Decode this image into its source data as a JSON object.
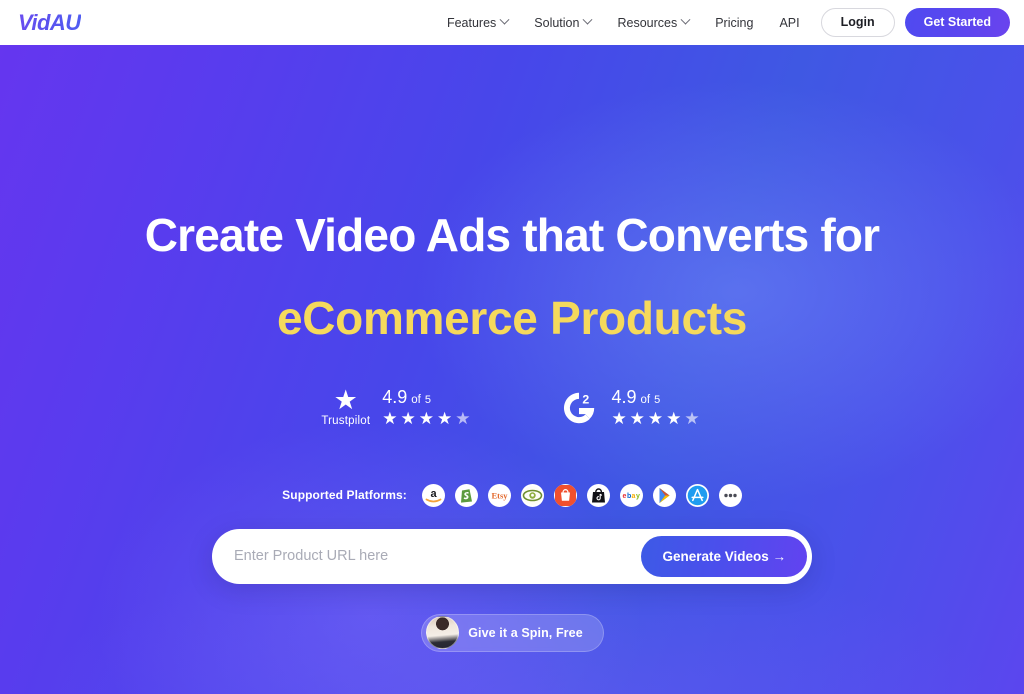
{
  "header": {
    "logo": "VidAU",
    "nav": [
      {
        "label": "Features",
        "has_caret": true
      },
      {
        "label": "Solution",
        "has_caret": true
      },
      {
        "label": "Resources",
        "has_caret": true
      },
      {
        "label": "Pricing",
        "has_caret": false
      },
      {
        "label": "API",
        "has_caret": false
      }
    ],
    "login_label": "Login",
    "get_started_label": "Get Started"
  },
  "hero": {
    "headline_line1": "Create Video Ads that Converts for",
    "headline_line2": "eCommerce Products",
    "accent_color": "#f5d95c",
    "bg_from": "#6536ef",
    "bg_to": "#3f58e3"
  },
  "ratings": [
    {
      "brand": "Trustpilot",
      "icon": "star-icon",
      "score": "4.9",
      "of_label": "of",
      "max": "5",
      "stars_full": 4,
      "stars_partial": 1
    },
    {
      "brand": "G2",
      "icon": "g2-logo-icon",
      "score": "4.9",
      "of_label": "of",
      "max": "5",
      "stars_full": 4,
      "stars_partial": 1
    }
  ],
  "platforms": {
    "label": "Supported Platforms:",
    "items": [
      {
        "name": "amazon-icon",
        "title": "Amazon"
      },
      {
        "name": "shopify-icon",
        "title": "Shopify"
      },
      {
        "name": "etsy-icon",
        "title": "Etsy"
      },
      {
        "name": "aliexpress-icon",
        "title": "AliExpress"
      },
      {
        "name": "shopee-icon",
        "title": "Shopee"
      },
      {
        "name": "tiktok-shop-icon",
        "title": "TikTok Shop"
      },
      {
        "name": "ebay-icon",
        "title": "eBay"
      },
      {
        "name": "google-play-icon",
        "title": "Google Play"
      },
      {
        "name": "app-store-icon",
        "title": "App Store"
      },
      {
        "name": "more-icon",
        "title": "More"
      }
    ]
  },
  "search": {
    "placeholder": "Enter Product URL here",
    "value": "",
    "button_label": "Generate Videos →"
  },
  "spin": {
    "label": "Give it a Spin, Free",
    "avatar": "user-avatar"
  }
}
